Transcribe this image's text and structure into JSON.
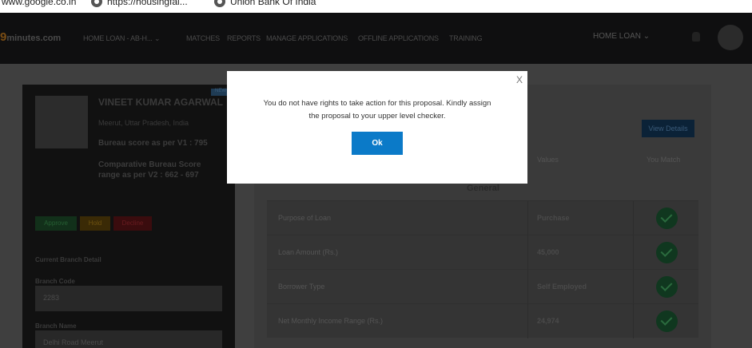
{
  "bookmarks": [
    {
      "label": "www.google.co.in"
    },
    {
      "label": "https://housingfai..."
    },
    {
      "label": "Union Bank Of India"
    }
  ],
  "nav": {
    "logo_prefix": "9",
    "logo_text": "minutes.com",
    "items": [
      "HOME LOAN - AB-H...",
      "MATCHES",
      "REPORTS",
      "MANAGE APPLICATIONS",
      "OFFLINE APPLICATIONS",
      "TRAINING"
    ],
    "right_label": "HOME LOAN"
  },
  "profile": {
    "name": "VINEET KUMAR AGARWAL",
    "location": "Meerut, Uttar Pradesh, India",
    "bureau_v1": "Bureau score as per V1 : 795",
    "bureau_v2": "Comparative Bureau Score range as per V2 : 662 - 697",
    "badge": "NEW"
  },
  "actions": {
    "approve": "Approve",
    "hold": "Hold",
    "decline": "Decline"
  },
  "branch": {
    "section_title": "Current Branch Detail",
    "code_label": "Branch Code",
    "code_value": "2283",
    "name_label": "Branch Name",
    "name_value": "Delhi Road Meerut"
  },
  "matches": {
    "view_details": "View Details",
    "col_values": "Values",
    "col_match": "You Match",
    "group": "General",
    "rows": [
      {
        "label": "Purpose of Loan",
        "value": "Purchase"
      },
      {
        "label": "Loan Amount (Rs.)",
        "value": "45,000"
      },
      {
        "label": "Borrower Type",
        "value": "Self Employed"
      },
      {
        "label": "Net Monthly Income Range (Rs.)",
        "value": "24,974"
      }
    ]
  },
  "modal": {
    "close": "X",
    "message": "You do not have rights to take action for this proposal. Kindly assign the proposal to your upper level checker.",
    "ok_label": "Ok"
  }
}
